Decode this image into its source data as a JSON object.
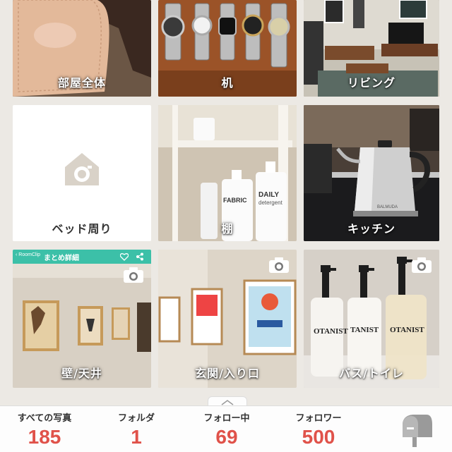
{
  "tiles": [
    {
      "label": "部屋全体"
    },
    {
      "label": "机"
    },
    {
      "label": "リビング"
    },
    {
      "label": "ベッド周り"
    },
    {
      "label": "棚"
    },
    {
      "label": "キッチン"
    },
    {
      "label": "壁/天井"
    },
    {
      "label": "玄関/入り口"
    },
    {
      "label": "バス/トイレ"
    }
  ],
  "shelf_text": {
    "bottle1": "FABRIC",
    "bottle2": "DAILY",
    "bottle2_sub": "detergent"
  },
  "botanist_text": {
    "b1": "OTANIST",
    "b2": "TANIST",
    "b3": "OTANIST"
  },
  "kettle_brand": "BALMUDA",
  "wall_header": {
    "back": "‹ RoomClip",
    "title": "まとめ詳細"
  },
  "stats": [
    {
      "label": "すべての写真",
      "value": "185"
    },
    {
      "label": "フォルダ",
      "value": "1"
    },
    {
      "label": "フォロー中",
      "value": "69"
    },
    {
      "label": "フォロワー",
      "value": "500"
    }
  ],
  "colors": {
    "accent": "#e0524a",
    "teal": "#3cc0a8",
    "background": "#ece9e4"
  },
  "icons": [
    "camera-plus-icon",
    "camera-icon",
    "heart-icon",
    "share-icon",
    "mailbox-icon",
    "chevron-up-icon"
  ]
}
